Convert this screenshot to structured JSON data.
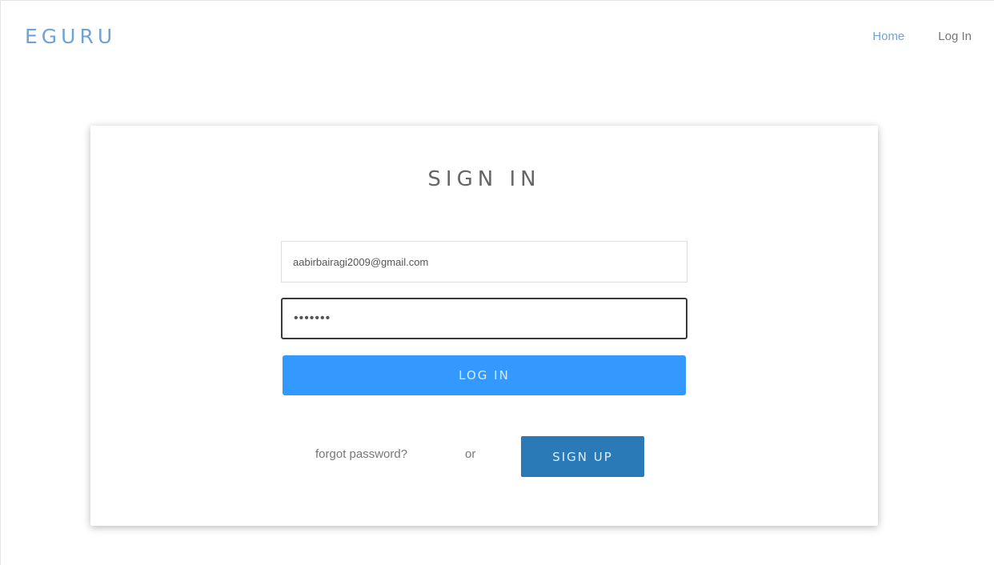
{
  "header": {
    "brand": "EGURU",
    "nav": {
      "home": "Home",
      "login": "Log In"
    }
  },
  "signin": {
    "title": "SIGN IN",
    "email_value": "aabirbairagi2009@gmail.com",
    "password_value": "•••••••",
    "login_button": "LOG IN",
    "forgot_link": "forgot password?",
    "or_text": "or",
    "signup_button": "SIGN UP"
  },
  "colors": {
    "brand": "#6fa3d6",
    "login_button": "#3399ff",
    "signup_button": "#2a7ab8"
  }
}
